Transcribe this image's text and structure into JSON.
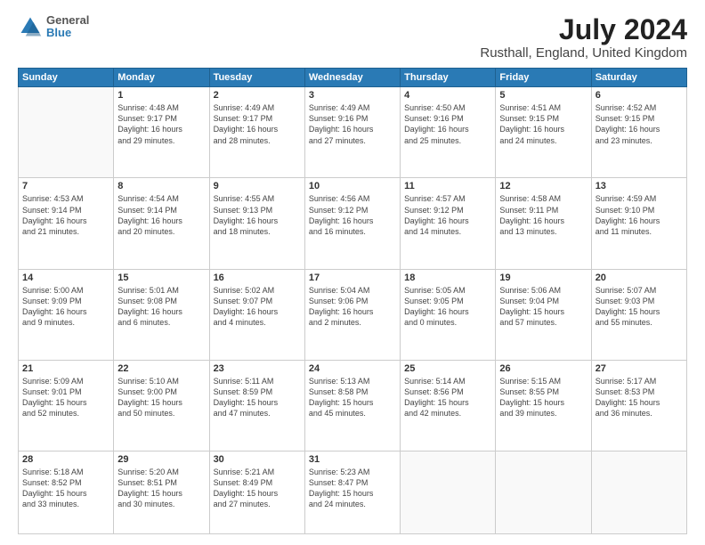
{
  "header": {
    "logo": {
      "line1": "General",
      "line2": "Blue"
    },
    "title": "July 2024",
    "subtitle": "Rusthall, England, United Kingdom"
  },
  "days_of_week": [
    "Sunday",
    "Monday",
    "Tuesday",
    "Wednesday",
    "Thursday",
    "Friday",
    "Saturday"
  ],
  "weeks": [
    [
      {
        "day": null,
        "content": ""
      },
      {
        "day": "1",
        "content": "Sunrise: 4:48 AM\nSunset: 9:17 PM\nDaylight: 16 hours\nand 29 minutes."
      },
      {
        "day": "2",
        "content": "Sunrise: 4:49 AM\nSunset: 9:17 PM\nDaylight: 16 hours\nand 28 minutes."
      },
      {
        "day": "3",
        "content": "Sunrise: 4:49 AM\nSunset: 9:16 PM\nDaylight: 16 hours\nand 27 minutes."
      },
      {
        "day": "4",
        "content": "Sunrise: 4:50 AM\nSunset: 9:16 PM\nDaylight: 16 hours\nand 25 minutes."
      },
      {
        "day": "5",
        "content": "Sunrise: 4:51 AM\nSunset: 9:15 PM\nDaylight: 16 hours\nand 24 minutes."
      },
      {
        "day": "6",
        "content": "Sunrise: 4:52 AM\nSunset: 9:15 PM\nDaylight: 16 hours\nand 23 minutes."
      }
    ],
    [
      {
        "day": "7",
        "content": "Sunrise: 4:53 AM\nSunset: 9:14 PM\nDaylight: 16 hours\nand 21 minutes."
      },
      {
        "day": "8",
        "content": "Sunrise: 4:54 AM\nSunset: 9:14 PM\nDaylight: 16 hours\nand 20 minutes."
      },
      {
        "day": "9",
        "content": "Sunrise: 4:55 AM\nSunset: 9:13 PM\nDaylight: 16 hours\nand 18 minutes."
      },
      {
        "day": "10",
        "content": "Sunrise: 4:56 AM\nSunset: 9:12 PM\nDaylight: 16 hours\nand 16 minutes."
      },
      {
        "day": "11",
        "content": "Sunrise: 4:57 AM\nSunset: 9:12 PM\nDaylight: 16 hours\nand 14 minutes."
      },
      {
        "day": "12",
        "content": "Sunrise: 4:58 AM\nSunset: 9:11 PM\nDaylight: 16 hours\nand 13 minutes."
      },
      {
        "day": "13",
        "content": "Sunrise: 4:59 AM\nSunset: 9:10 PM\nDaylight: 16 hours\nand 11 minutes."
      }
    ],
    [
      {
        "day": "14",
        "content": "Sunrise: 5:00 AM\nSunset: 9:09 PM\nDaylight: 16 hours\nand 9 minutes."
      },
      {
        "day": "15",
        "content": "Sunrise: 5:01 AM\nSunset: 9:08 PM\nDaylight: 16 hours\nand 6 minutes."
      },
      {
        "day": "16",
        "content": "Sunrise: 5:02 AM\nSunset: 9:07 PM\nDaylight: 16 hours\nand 4 minutes."
      },
      {
        "day": "17",
        "content": "Sunrise: 5:04 AM\nSunset: 9:06 PM\nDaylight: 16 hours\nand 2 minutes."
      },
      {
        "day": "18",
        "content": "Sunrise: 5:05 AM\nSunset: 9:05 PM\nDaylight: 16 hours\nand 0 minutes."
      },
      {
        "day": "19",
        "content": "Sunrise: 5:06 AM\nSunset: 9:04 PM\nDaylight: 15 hours\nand 57 minutes."
      },
      {
        "day": "20",
        "content": "Sunrise: 5:07 AM\nSunset: 9:03 PM\nDaylight: 15 hours\nand 55 minutes."
      }
    ],
    [
      {
        "day": "21",
        "content": "Sunrise: 5:09 AM\nSunset: 9:01 PM\nDaylight: 15 hours\nand 52 minutes."
      },
      {
        "day": "22",
        "content": "Sunrise: 5:10 AM\nSunset: 9:00 PM\nDaylight: 15 hours\nand 50 minutes."
      },
      {
        "day": "23",
        "content": "Sunrise: 5:11 AM\nSunset: 8:59 PM\nDaylight: 15 hours\nand 47 minutes."
      },
      {
        "day": "24",
        "content": "Sunrise: 5:13 AM\nSunset: 8:58 PM\nDaylight: 15 hours\nand 45 minutes."
      },
      {
        "day": "25",
        "content": "Sunrise: 5:14 AM\nSunset: 8:56 PM\nDaylight: 15 hours\nand 42 minutes."
      },
      {
        "day": "26",
        "content": "Sunrise: 5:15 AM\nSunset: 8:55 PM\nDaylight: 15 hours\nand 39 minutes."
      },
      {
        "day": "27",
        "content": "Sunrise: 5:17 AM\nSunset: 8:53 PM\nDaylight: 15 hours\nand 36 minutes."
      }
    ],
    [
      {
        "day": "28",
        "content": "Sunrise: 5:18 AM\nSunset: 8:52 PM\nDaylight: 15 hours\nand 33 minutes."
      },
      {
        "day": "29",
        "content": "Sunrise: 5:20 AM\nSunset: 8:51 PM\nDaylight: 15 hours\nand 30 minutes."
      },
      {
        "day": "30",
        "content": "Sunrise: 5:21 AM\nSunset: 8:49 PM\nDaylight: 15 hours\nand 27 minutes."
      },
      {
        "day": "31",
        "content": "Sunrise: 5:23 AM\nSunset: 8:47 PM\nDaylight: 15 hours\nand 24 minutes."
      },
      {
        "day": null,
        "content": ""
      },
      {
        "day": null,
        "content": ""
      },
      {
        "day": null,
        "content": ""
      }
    ]
  ]
}
